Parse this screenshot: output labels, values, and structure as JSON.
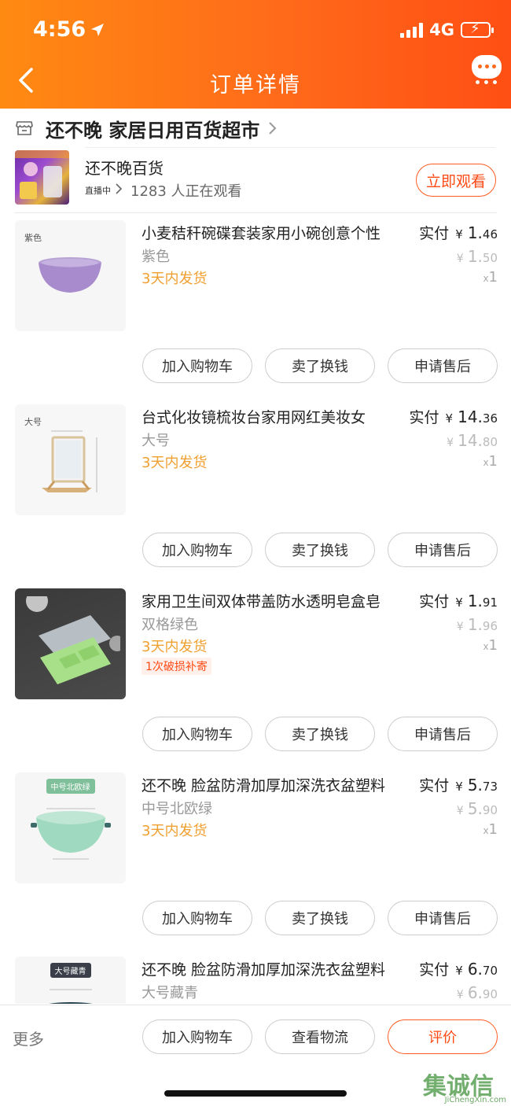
{
  "status_bar": {
    "time": "4:56",
    "network": "4G"
  },
  "header": {
    "title": "订单详情"
  },
  "shop": {
    "name": "还不晚 家居日用百货超市"
  },
  "live": {
    "title": "还不晚百货",
    "tag": "直播中",
    "viewers": "1283 人正在观看",
    "watch_label": "立即观看"
  },
  "items": [
    {
      "name": "小麦秸秆碗碟套装家用小碗创意个性",
      "thumb_label": "紫色",
      "sku": "紫色",
      "shipping": "3天内发货",
      "pay_label": "实付",
      "price_symbol": "¥",
      "pay_int": "1.",
      "pay_dec": "46",
      "orig_int": "1.",
      "orig_dec": "50",
      "qty": "1",
      "qty_prefix": "x",
      "buttons": [
        "加入购物车",
        "卖了换钱",
        "申请售后"
      ]
    },
    {
      "name": "台式化妆镜梳妆台家用网红美妆女",
      "thumb_label": "大号",
      "sku": "大号",
      "shipping": "3天内发货",
      "pay_label": "实付",
      "price_symbol": "¥",
      "pay_int": "14.",
      "pay_dec": "36",
      "orig_int": "14.",
      "orig_dec": "80",
      "qty": "1",
      "qty_prefix": "x",
      "buttons": [
        "加入购物车",
        "卖了换钱",
        "申请售后"
      ]
    },
    {
      "name": "家用卫生间双体带盖防水透明皂盒皂",
      "sku": "双格绿色",
      "shipping": "3天内发货",
      "promo": "1次破损补寄",
      "pay_label": "实付",
      "price_symbol": "¥",
      "pay_int": "1.",
      "pay_dec": "91",
      "orig_int": "1.",
      "orig_dec": "96",
      "qty": "1",
      "qty_prefix": "x",
      "buttons": [
        "加入购物车",
        "卖了换钱",
        "申请售后"
      ]
    },
    {
      "name": "还不晚 脸盆防滑加厚加深洗衣盆塑料",
      "thumb_tag": "中号北欧绿",
      "sku": "中号北欧绿",
      "shipping": "3天内发货",
      "pay_label": "实付",
      "price_symbol": "¥",
      "pay_int": "5.",
      "pay_dec": "73",
      "orig_int": "5.",
      "orig_dec": "90",
      "qty": "1",
      "qty_prefix": "x",
      "buttons": [
        "加入购物车",
        "卖了换钱",
        "申请售后"
      ]
    },
    {
      "name": "还不晚 脸盆防滑加厚加深洗衣盆塑料",
      "thumb_tag": "大号藏青",
      "sku": "大号藏青",
      "pay_label": "实付",
      "price_symbol": "¥",
      "pay_int": "6.",
      "pay_dec": "70",
      "orig_int": "6.",
      "orig_dec": "90"
    }
  ],
  "bottom_bar": {
    "more": "更多",
    "add_cart": "加入购物车",
    "logistics": "查看物流",
    "review": "评价"
  },
  "watermark": {
    "logo": "集诚信",
    "text": "JiChengXin.com"
  },
  "colors": {
    "accent": "#ff5a1f",
    "shipping": "#f0a030",
    "header_start": "#ff8a12",
    "header_end": "#ff4f14"
  }
}
